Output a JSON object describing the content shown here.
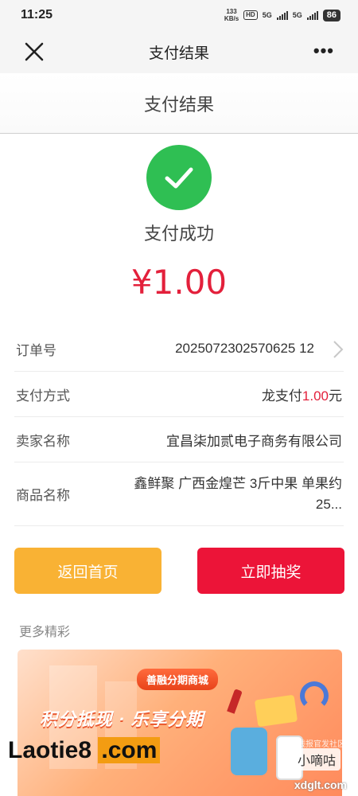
{
  "status_bar": {
    "time": "11:25",
    "net_speed_value": "133",
    "net_speed_unit": "KB/s",
    "hd_label": "HD",
    "signal1_label": "5G",
    "signal2_label": "5G",
    "battery": "86"
  },
  "nav": {
    "title": "支付结果",
    "close_icon": "close-icon",
    "more_icon": "more-icon"
  },
  "subheader": {
    "title": "支付结果"
  },
  "result": {
    "status_text": "支付成功",
    "amount": "¥1.00",
    "status_color": "#2fbf53",
    "amount_color": "#e3203b"
  },
  "details": {
    "order_label": "订单号",
    "order_value": "2025072302570625 12",
    "payment_label": "支付方式",
    "payment_method": "龙支付",
    "payment_amount": "1.00",
    "payment_currency": "元",
    "seller_label": "卖家名称",
    "seller_value": "宜昌柒加贰电子商务有限公司",
    "product_label": "商品名称",
    "product_value": "鑫鲜聚 广西金煌芒 3斤中果 单果约25..."
  },
  "actions": {
    "home_label": "返回首页",
    "lottery_label": "立即抽奖",
    "home_color": "#f9b234",
    "lottery_color": "#ec1438"
  },
  "more": {
    "title": "更多精彩"
  },
  "banner": {
    "tag": "善融分期商城",
    "headline": "积分抵现 · 乐享分期"
  },
  "watermark": {
    "brand_prefix": "Laotie8",
    "brand_suffix": ".com",
    "xiao": "小嘀咕",
    "small": "线报官发社区",
    "site": "xdglt.com"
  }
}
